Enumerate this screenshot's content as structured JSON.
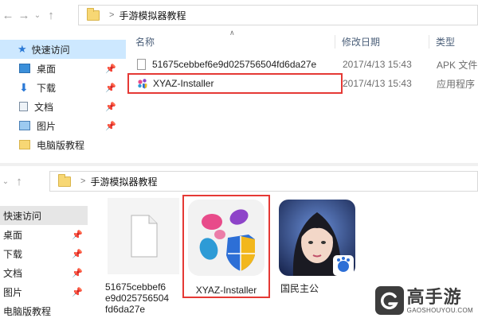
{
  "top": {
    "nav": {
      "back": "←",
      "forward": "→",
      "up": "↑",
      "separator": ">"
    },
    "breadcrumb": "手游模拟器教程",
    "columns": {
      "name": "名称",
      "date": "修改日期",
      "type": "类型"
    },
    "sidebar": [
      {
        "label": "快速访问",
        "pinned": false
      },
      {
        "label": "桌面",
        "pinned": true
      },
      {
        "label": "下载",
        "pinned": true
      },
      {
        "label": "文档",
        "pinned": true
      },
      {
        "label": "图片",
        "pinned": true
      },
      {
        "label": "电脑版教程",
        "pinned": false
      }
    ],
    "files": [
      {
        "name": "51675cebbef6e9d025756504fd6da27e",
        "date": "2017/4/13 15:43",
        "type": "APK 文件"
      },
      {
        "name": "XYAZ-Installer",
        "date": "2017/4/13 15:43",
        "type": "应用程序"
      }
    ]
  },
  "bottom": {
    "breadcrumb": "手游模拟器教程",
    "separator": ">",
    "sidebar": [
      {
        "label": "快速访问"
      },
      {
        "label": "桌面"
      },
      {
        "label": "下载"
      },
      {
        "label": "文档"
      },
      {
        "label": "图片"
      },
      {
        "label": "电脑版教程"
      }
    ],
    "tiles": [
      {
        "label": "51675cebbef6e9d025756504fd6da27e"
      },
      {
        "label": "XYAZ-Installer"
      },
      {
        "label": "国民主公"
      }
    ]
  },
  "watermark": {
    "main": "高手游",
    "sub": "GAOSHOUYOU.COM"
  },
  "colors": {
    "highlight": "#e53935",
    "selection": "#cde8ff"
  }
}
